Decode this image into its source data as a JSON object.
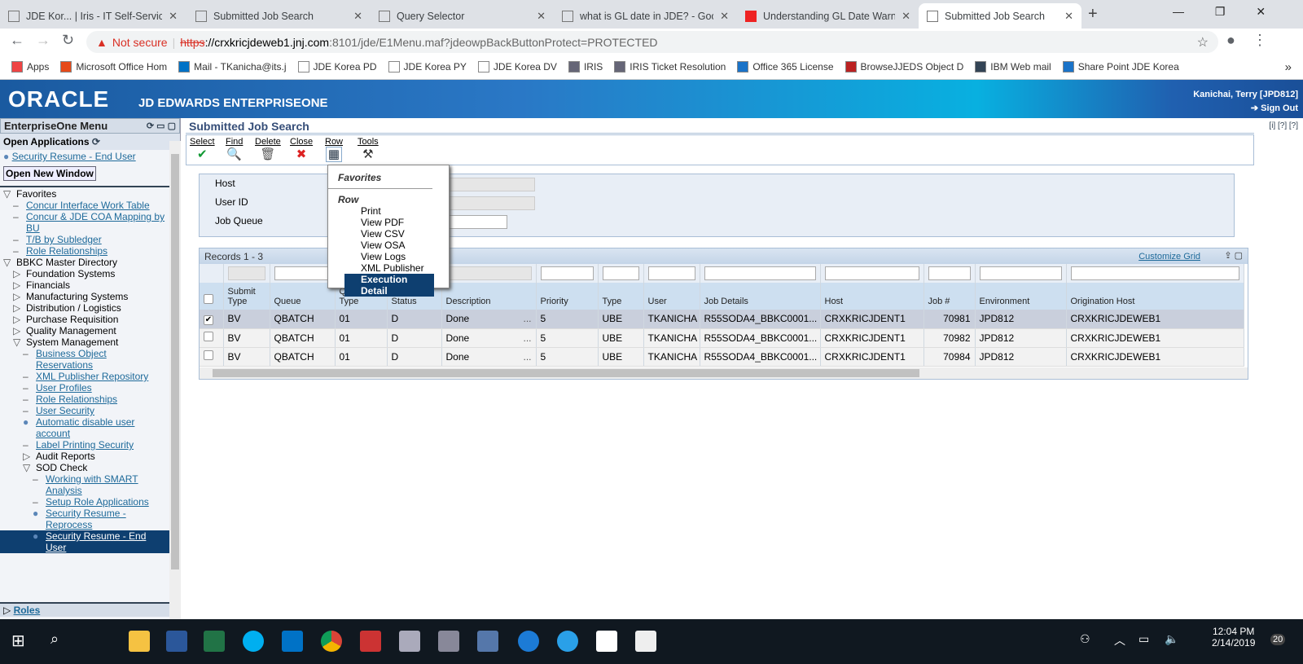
{
  "browser": {
    "tabs": [
      {
        "title": "JDE Kor... | Iris - IT Self-Service I",
        "icon": "iris-icon"
      },
      {
        "title": "Submitted Job Search",
        "icon": "page-icon"
      },
      {
        "title": "Query Selector",
        "icon": "page-icon"
      },
      {
        "title": "what is GL date in JDE? - Googl",
        "icon": "google-icon"
      },
      {
        "title": "Understanding GL Date Warnin",
        "icon": "oracle-icon"
      },
      {
        "title": "Submitted Job Search",
        "icon": "page-icon",
        "active": true
      }
    ],
    "security": "Not secure",
    "url_scheme": "https",
    "url_host": "://crxkricjdeweb1.jnj.com",
    "url_rest": ":8101/jde/E1Menu.maf?jdeowpBackButtonProtect=PROTECTED",
    "bookmarks": [
      "Apps",
      "Microsoft Office Hom",
      "Mail - TKanicha@its.j",
      "JDE Korea PD",
      "JDE Korea PY",
      "JDE Korea DV",
      "IRIS",
      "IRIS Ticket Resolution",
      "Office 365 License",
      "BrowseJJEDS Object D",
      "IBM Web mail",
      "Share Point JDE Korea"
    ],
    "more": "»"
  },
  "header": {
    "logo": "ORACLE",
    "product": "JD EDWARDS ENTERPRISEONE",
    "user": "Kanichai, Terry  [JPD812]",
    "signout": "Sign Out"
  },
  "menu": {
    "title": "EnterpriseOne Menu",
    "open_apps": "Open Applications",
    "open_app_item": "Security Resume - End User",
    "open_new_window": "Open New Window",
    "tree": [
      {
        "label": "Favorites",
        "type": "open",
        "lvl": 0
      },
      {
        "label": "Concur Interface Work Table",
        "type": "link",
        "lvl": 1
      },
      {
        "label": "Concur & JDE COA Mapping by BU",
        "type": "link",
        "lvl": 1
      },
      {
        "label": "T/B by Subledger",
        "type": "link",
        "lvl": 1
      },
      {
        "label": "Role Relationships",
        "type": "link",
        "lvl": 1
      },
      {
        "label": "BBKC Master Directory",
        "type": "open",
        "lvl": 0
      },
      {
        "label": "Foundation Systems",
        "type": "closed",
        "lvl": 1
      },
      {
        "label": "Financials",
        "type": "closed",
        "lvl": 1
      },
      {
        "label": "Manufacturing Systems",
        "type": "closed",
        "lvl": 1
      },
      {
        "label": "Distribution / Logistics",
        "type": "closed",
        "lvl": 1
      },
      {
        "label": "Purchase Requisition",
        "type": "closed",
        "lvl": 1
      },
      {
        "label": "Quality Management",
        "type": "closed",
        "lvl": 1
      },
      {
        "label": "System Management",
        "type": "open",
        "lvl": 1
      },
      {
        "label": "Business Object Reservations",
        "type": "link",
        "lvl": 2
      },
      {
        "label": "XML Publisher Repository",
        "type": "link",
        "lvl": 2
      },
      {
        "label": "User Profiles",
        "type": "link",
        "lvl": 2
      },
      {
        "label": "Role Relationships",
        "type": "link",
        "lvl": 2
      },
      {
        "label": "User Security",
        "type": "link",
        "lvl": 2
      },
      {
        "label": "Automatic disable user account",
        "type": "dot",
        "lvl": 2
      },
      {
        "label": "Label Printing Security",
        "type": "link",
        "lvl": 2
      },
      {
        "label": "Audit Reports",
        "type": "closed",
        "lvl": 2
      },
      {
        "label": "SOD Check",
        "type": "open",
        "lvl": 2
      },
      {
        "label": "Working with SMART Analysis",
        "type": "link",
        "lvl": 3
      },
      {
        "label": "Setup Role Applications",
        "type": "link",
        "lvl": 3
      },
      {
        "label": "Security Resume - Reprocess",
        "type": "dot",
        "lvl": 3
      },
      {
        "label": "Security Resume - End User",
        "type": "dot",
        "lvl": 3,
        "selected": true
      }
    ],
    "roles": "Roles"
  },
  "app": {
    "title": "Submitted Job Search",
    "toolbar": [
      "Select",
      "Find",
      "Delete",
      "Close",
      "Row",
      "Tools"
    ],
    "fields": [
      "Host",
      "User ID",
      "Job Queue"
    ],
    "records": "Records 1 - 3",
    "customize": "Customize Grid",
    "columns": [
      "Submit Type",
      "Queue",
      "Queue Type",
      "Status",
      "Description",
      "Priority",
      "Type",
      "User",
      "Job Details",
      "Host",
      "Job #",
      "Environment",
      "Origination Host"
    ],
    "rows": [
      {
        "checked": true,
        "cells": [
          "BV",
          "QBATCH",
          "01",
          "D",
          "Done",
          "5",
          "UBE",
          "TKANICHA",
          "R55SODA4_BBKC0001...",
          "CRXKRICJDENT1",
          "70981",
          "JPD812",
          "CRXKRICJDEWEB1"
        ]
      },
      {
        "checked": false,
        "cells": [
          "BV",
          "QBATCH",
          "01",
          "D",
          "Done",
          "5",
          "UBE",
          "TKANICHA",
          "R55SODA4_BBKC0001...",
          "CRXKRICJDENT1",
          "70982",
          "JPD812",
          "CRXKRICJDEWEB1"
        ]
      },
      {
        "checked": false,
        "cells": [
          "BV",
          "QBATCH",
          "01",
          "D",
          "Done",
          "5",
          "UBE",
          "TKANICHA",
          "R55SODA4_BBKC0001...",
          "CRXKRICJDENT1",
          "70984",
          "JPD812",
          "CRXKRICJDEWEB1"
        ]
      }
    ],
    "ellipsis": "...",
    "row_menu": {
      "favorites": "Favorites",
      "section": "Row",
      "items": [
        "Print",
        "View PDF",
        "View CSV",
        "View OSA",
        "View Logs",
        "XML Publisher",
        "Execution Detail"
      ],
      "highlighted": "Execution Detail"
    }
  },
  "taskbar": {
    "time": "12:04 PM",
    "date": "2/14/2019",
    "notifications": "20"
  }
}
